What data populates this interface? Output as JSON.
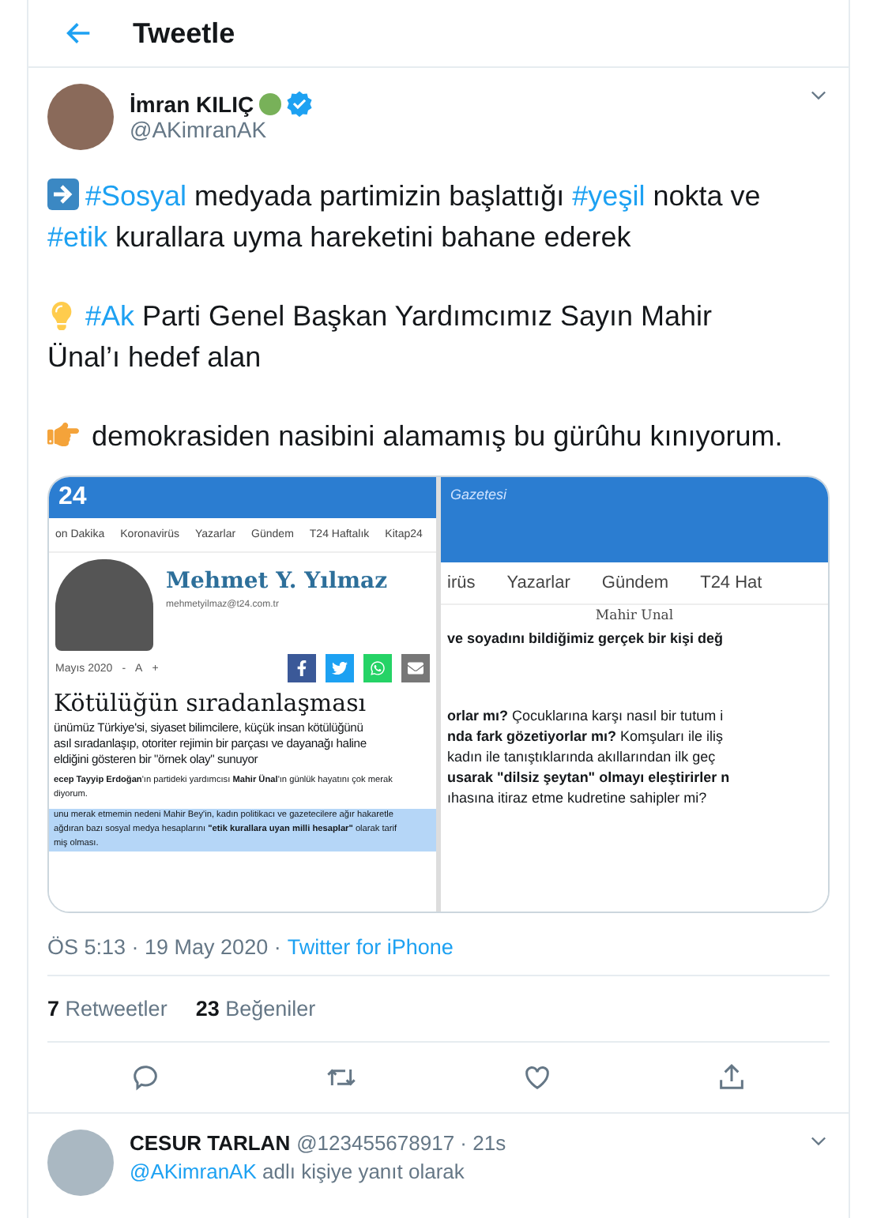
{
  "header": {
    "title": "Tweetle"
  },
  "tweet": {
    "author": {
      "name": "İmran KILIÇ",
      "handle": "@AKimranAK",
      "verified": true
    },
    "paragraphs": [
      {
        "segments": [
          {
            "kind": "hashtag",
            "text": "#Sosyal"
          },
          {
            "kind": "text",
            "text": " medyada partimizin başlattığı "
          },
          {
            "kind": "hashtag",
            "text": "#yeşil"
          },
          {
            "kind": "text",
            "text": " nokta ve "
          },
          {
            "kind": "hashtag",
            "text": "#etik"
          },
          {
            "kind": "text",
            "text": " kurallara uyma hareketini bahane ederek"
          }
        ]
      },
      {
        "segments": [
          {
            "kind": "hashtag",
            "text": "#Ak"
          },
          {
            "kind": "text",
            "text": " Parti Genel Başkan Yardımcımız Sayın Mahir Ünal’ı hedef alan"
          }
        ]
      },
      {
        "segments": [
          {
            "kind": "text",
            "text": "demokrasiden nasibini alamamış bu gürûhu kınıyorum."
          }
        ]
      }
    ],
    "media": {
      "left": {
        "logo": "24",
        "nav": [
          "on Dakika",
          "Koronavirüs",
          "Yazarlar",
          "Gündem",
          "T24 Haftalık",
          "Kitap24"
        ],
        "author": "Mehmet Y. Yılmaz",
        "email": "mehmetyilmaz@t24.com.tr",
        "date": "Mayıs 2020",
        "font_controls": [
          "-",
          "A",
          "+"
        ],
        "title": "Kötülüğün sıradanlaşması",
        "lead": [
          "ünümüz Türkiye'si, siyaset bilimcilere, küçük insan kötülüğünü",
          "asıl sıradanlaşıp, otoriter rejimin bir parçası ve dayanağı haline",
          "eldiğini gösteren bir \"örnek olay\" sunuyor"
        ],
        "body": [
          "**ecep Tayyip Erdoğan**'ın partideki yardımcısı **Mahir Ünal**'ın günlük hayatını çok merak",
          "diyorum."
        ],
        "highlight": [
          "unu merak etmemin nedeni Mahir Bey'in, kadın politikacı ve gazetecilere ağır hakaretle",
          "ağdıran bazı sosyal medya hesaplarını **\"etik kurallara uyan milli hesaplar\"** olarak tarif",
          "miş olması."
        ]
      },
      "right": {
        "brand": "Gazetesi",
        "nav": [
          "irüs",
          "Yazarlar",
          "Gündem",
          "T24 Hat"
        ],
        "caption": "Mahir Unal",
        "headline": "ve soyadını bildiğimiz gerçek bir kişi değ",
        "lines": [
          "**orlar mı?** Çocuklarına karşı nasıl bir tutum i",
          "**nda fark gözetiyorlar mı?** Komşuları ile iliş",
          "kadın ile tanıştıklarında akıllarından ilk geç",
          "**usarak \"dilsiz şeytan\" olmayı eleştirirler n**",
          "ıhasına itiraz etme kudretine sahipler mi?"
        ]
      }
    },
    "time": "ÖS 5:13 · 19 May 2020 ·",
    "source": "Twitter for iPhone",
    "stats": [
      {
        "count": "7",
        "label": "Retweetler"
      },
      {
        "count": "23",
        "label": "Beğeniler"
      }
    ]
  },
  "reply": {
    "name": "CESUR TARLAN",
    "handle": "@123455678917 · 21s",
    "mention": "@AKimranAK",
    "context": "adlı kişiye yanıt olarak"
  }
}
